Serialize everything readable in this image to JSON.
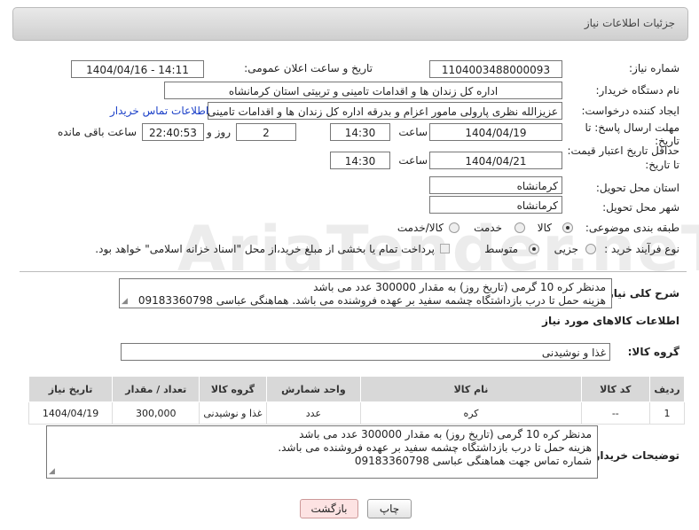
{
  "header": {
    "title": "جزئیات اطلاعات نیاز"
  },
  "watermark": "AriaTender.neT",
  "fields": {
    "need_number_label": "شماره نیاز:",
    "need_number": "1104003488000093",
    "announce_label": "تاریخ و ساعت اعلان عمومی:",
    "announce_value": "1404/04/16 - 14:11",
    "buyer_org_label": "نام دستگاه خریدار:",
    "buyer_org": "اداره کل زندان ها و اقدامات تامینی و تربیتی استان کرمانشاه",
    "creator_label": "ایجاد کننده درخواست:",
    "creator": "عزیزالله نظری پارولی مامور اعزام و بدرقه اداره کل زندان ها و اقدامات تامینی و تربیتی استان کرمانشاه",
    "contact_link": "اطلاعات تماس خریدار",
    "deadline_label_1": "مهلت ارسال پاسخ: تا",
    "deadline_label_2": "تاریخ:",
    "deadline_date": "1404/04/19",
    "time_label": "ساعت",
    "deadline_time": "14:30",
    "days_value": "2",
    "days_label": "روز و",
    "remaining_time": "22:40:53",
    "remaining_label": "ساعت باقی مانده",
    "validity_label_1": "حداقل تاریخ اعتبار قیمت:",
    "validity_label_2": "تا تاریخ:",
    "validity_date": "1404/04/21",
    "validity_time": "14:30",
    "province_label": "استان محل تحویل:",
    "province": "کرمانشاه",
    "city_label": "شهر محل تحویل:",
    "city": "کرمانشاه",
    "category_label": "طبقه بندی موضوعی:",
    "category_options": [
      "کالا",
      "خدمت",
      "کالا/خدمت"
    ],
    "process_label": "نوع فرآیند خرید :",
    "process_options": [
      "جزیی",
      "متوسط"
    ],
    "payment_note": "پرداخت تمام یا بخشی از مبلغ خرید،از محل \"اسناد خزانه اسلامی\" خواهد بود."
  },
  "general_description": {
    "label": "شرح کلی نیاز:",
    "lines": [
      "مدنظر کره 10 گرمی (تاریخ روز) به مقدار 300000 عدد می باشد",
      "هزینه حمل تا درب بازداشتگاه چشمه سفید بر عهده فروشنده می باشد. هماهنگی عباسی 09183360798"
    ]
  },
  "goods_info": {
    "title": "اطلاعات کالاهای مورد نیاز",
    "group_label": "گروه کالا:",
    "group_value": "غذا و نوشیدنی"
  },
  "table": {
    "headers": [
      "ردیف",
      "کد کالا",
      "نام کالا",
      "واحد شمارش",
      "گروه کالا",
      "تعداد / مقدار",
      "تاریخ نیاز"
    ],
    "rows": [
      [
        "1",
        "--",
        "کره",
        "عدد",
        "غذا و نوشیدنی",
        "300,000",
        "1404/04/19"
      ]
    ]
  },
  "buyer_notes": {
    "label": "توضیحات خریدار:",
    "lines": [
      "مدنظر کره 10 گرمی (تاریخ روز) به مقدار 300000 عدد می باشد",
      "هزینه حمل تا درب بازداشتگاه چشمه سفید بر عهده فروشنده می باشد.",
      "شماره تماس جهت هماهنگی عباسی 09183360798"
    ]
  },
  "buttons": {
    "print": "چاپ",
    "back": "بازگشت"
  },
  "colors": {
    "link": "#1a3fc8",
    "header_bg": "#d6d6d6",
    "back_button": "#fde3e3"
  }
}
